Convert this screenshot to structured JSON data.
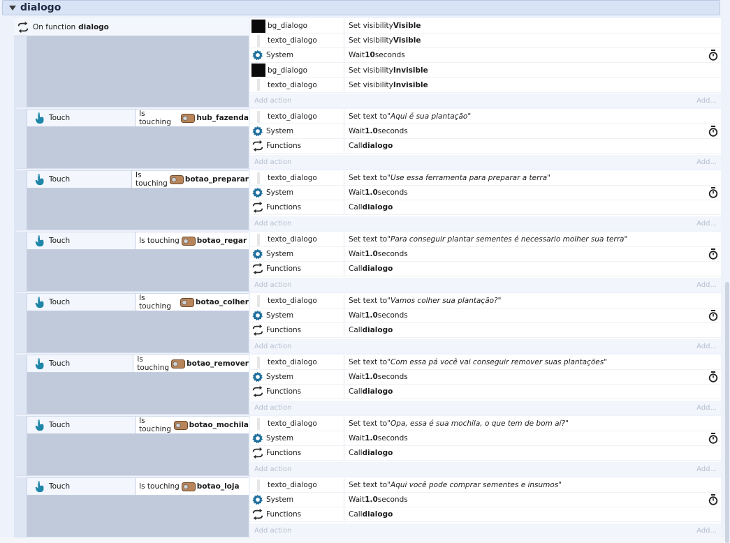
{
  "group": {
    "title": "dialogo"
  },
  "function_event": {
    "label": "On function",
    "name": "dialogo",
    "actions": [
      {
        "icon": "black-square-icon",
        "object": "bg_dialogo",
        "verb": "Set visibility",
        "arg": "Visible",
        "style": "bold"
      },
      {
        "icon": "text-object-icon",
        "object": "texto_dialogo",
        "verb": "Set visibility",
        "arg": "Visible",
        "style": "bold"
      },
      {
        "icon": "gear-icon",
        "object": "System",
        "verb": "Wait",
        "arg": "10",
        "suffix": "seconds",
        "style": "bold",
        "timer": true
      },
      {
        "icon": "black-square-icon",
        "object": "bg_dialogo",
        "verb": "Set visibility",
        "arg": "Invisible",
        "style": "bold"
      },
      {
        "icon": "text-object-icon",
        "object": "texto_dialogo",
        "verb": "Set visibility",
        "arg": "Invisible",
        "style": "bold"
      }
    ]
  },
  "add_action": "Add action",
  "add_short": "Add...",
  "touch_events": [
    {
      "object": "Touch",
      "cond": "Is touching",
      "target": "hub_fazenda",
      "text": "Aqui é sua plantação"
    },
    {
      "object": "Touch",
      "cond": "Is touching",
      "target": "botao_preparar",
      "text": "Use essa ferramenta para preparar a terra"
    },
    {
      "object": "Touch",
      "cond": "Is touching",
      "target": "botao_regar",
      "text": "Para conseguir plantar sementes é necessario molher sua terra"
    },
    {
      "object": "Touch",
      "cond": "Is touching",
      "target": "botao_colher",
      "text": "Vamos colher sua plantação?"
    },
    {
      "object": "Touch",
      "cond": "Is touching",
      "target": "botao_remover",
      "text": "Com essa pá você vai conseguir remover suas plantações"
    },
    {
      "object": "Touch",
      "cond": "Is touching",
      "target": "botao_mochila",
      "text": "Opa, essa é sua mochila, o que tem de bom aí?"
    },
    {
      "object": "Touch",
      "cond": "Is touching",
      "target": "botao_loja",
      "text": "Aqui você pode comprar sementes e insumos"
    }
  ],
  "touch_actions": {
    "text_object": "texto_dialogo",
    "set_text": "Set text to",
    "system": "System",
    "wait": "Wait",
    "wait_value": "1.0",
    "seconds": "seconds",
    "functions": "Functions",
    "call": "Call",
    "call_name": "dialogo"
  }
}
